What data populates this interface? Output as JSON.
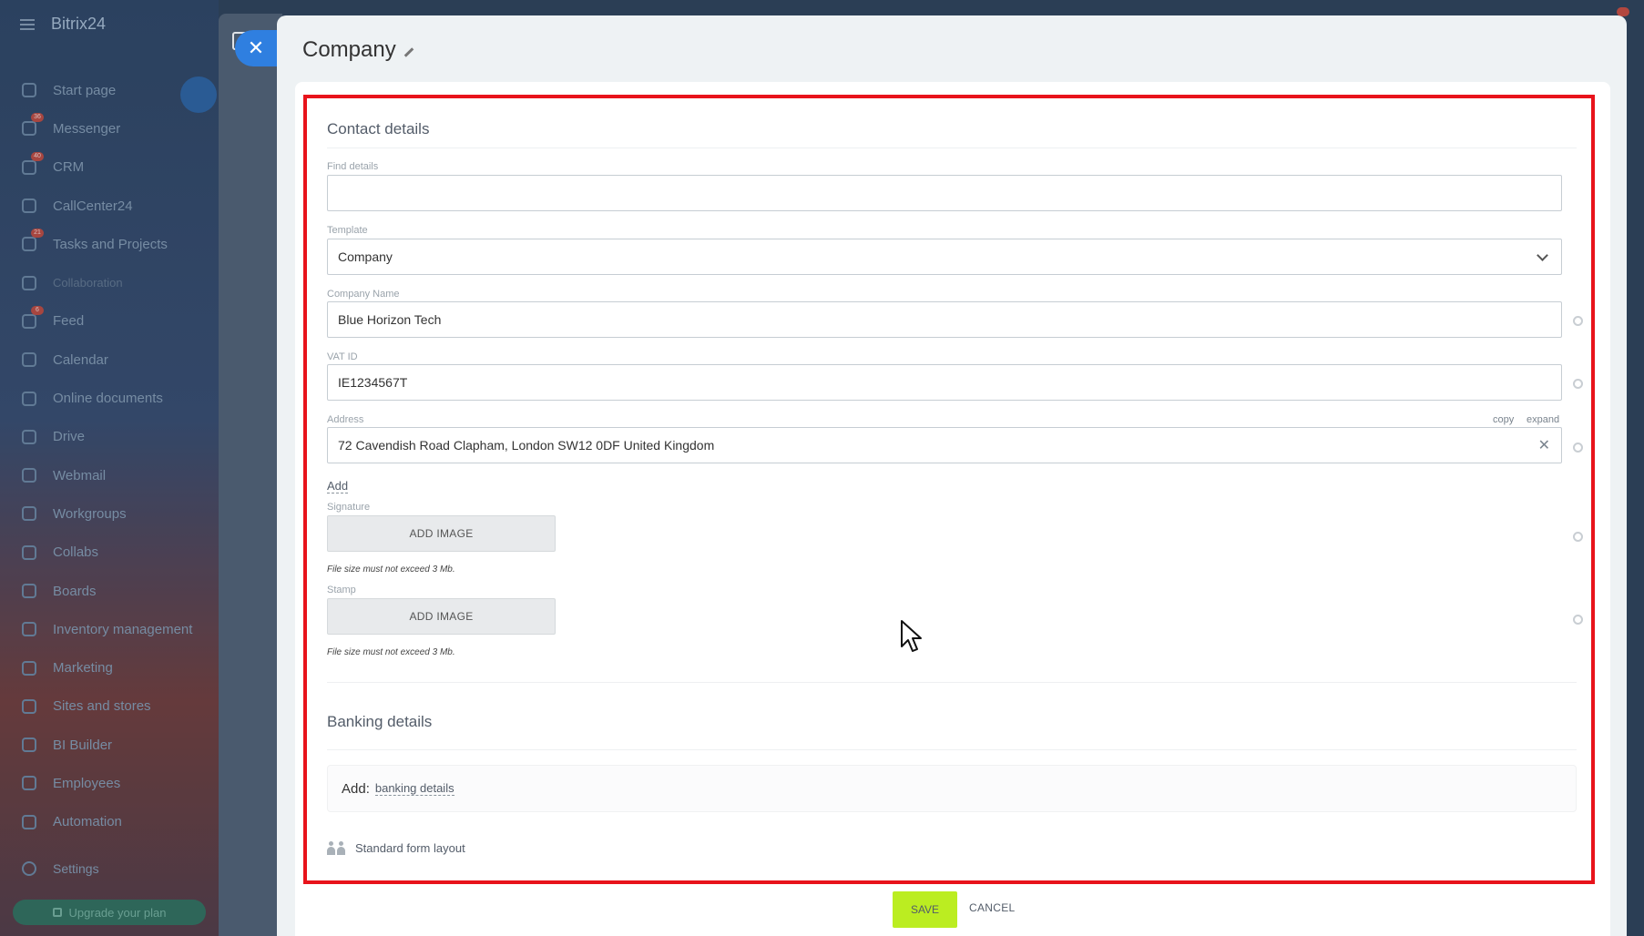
{
  "app": {
    "brand": "Bitrix24"
  },
  "sidebar": {
    "items": [
      {
        "label": "Start page",
        "icon": "home-icon",
        "badge": ""
      },
      {
        "label": "Messenger",
        "icon": "chat-icon",
        "badge": "36"
      },
      {
        "label": "CRM",
        "icon": "crm-icon",
        "badge": "40"
      },
      {
        "label": "CallCenter24",
        "icon": "phone-icon",
        "badge": ""
      },
      {
        "label": "Tasks and Projects",
        "icon": "tasks-icon",
        "badge": "21"
      },
      {
        "label": "Collaboration",
        "icon": "collab-icon",
        "badge": ""
      },
      {
        "label": "Feed",
        "icon": "feed-icon",
        "badge": "6"
      },
      {
        "label": "Calendar",
        "icon": "calendar-icon",
        "badge": ""
      },
      {
        "label": "Online documents",
        "icon": "document-icon",
        "badge": ""
      },
      {
        "label": "Drive",
        "icon": "drive-icon",
        "badge": ""
      },
      {
        "label": "Webmail",
        "icon": "mail-icon",
        "badge": ""
      },
      {
        "label": "Workgroups",
        "icon": "group-icon",
        "badge": ""
      },
      {
        "label": "Collabs",
        "icon": "collabs-icon",
        "badge": ""
      },
      {
        "label": "Boards",
        "icon": "board-icon",
        "badge": ""
      },
      {
        "label": "Inventory management",
        "icon": "inventory-icon",
        "badge": ""
      },
      {
        "label": "Marketing",
        "icon": "marketing-icon",
        "badge": ""
      },
      {
        "label": "Sites and stores",
        "icon": "cart-icon",
        "badge": ""
      },
      {
        "label": "BI Builder",
        "icon": "chart-icon",
        "badge": ""
      },
      {
        "label": "Employees",
        "icon": "employees-icon",
        "badge": ""
      },
      {
        "label": "Automation",
        "icon": "automation-icon",
        "badge": ""
      }
    ],
    "settings_label": "Settings",
    "upgrade_label": "Upgrade your plan"
  },
  "panel": {
    "close_glyph": "✕",
    "title": "Company"
  },
  "contact": {
    "section_title": "Contact details",
    "find_label": "Find details",
    "find_value": "",
    "template_label": "Template",
    "template_value": "Company",
    "company_name_label": "Company Name",
    "company_name_value": "Blue Horizon Tech",
    "vat_label": "VAT ID",
    "vat_value": "IE1234567T",
    "address_label": "Address",
    "address_copy": "copy",
    "address_expand": "expand",
    "address_value": "72 Cavendish Road Clapham, London SW12 0DF United Kingdom",
    "address_clear": "✕",
    "add_label": "Add",
    "signature_label": "Signature",
    "signature_button": "ADD IMAGE",
    "signature_hint": "File size must not exceed 3 Mb.",
    "stamp_label": "Stamp",
    "stamp_button": "ADD IMAGE",
    "stamp_hint": "File size must not exceed 3 Mb."
  },
  "banking": {
    "section_title": "Banking details",
    "add_prefix": "Add:",
    "add_link": "banking details"
  },
  "layout_label": "Standard form layout",
  "footer": {
    "save_label": "SAVE",
    "cancel_label": "CANCEL"
  },
  "colors": {
    "accent": "#2f7fe0",
    "save": "#bbed21",
    "highlight_frame": "#e8131b"
  }
}
